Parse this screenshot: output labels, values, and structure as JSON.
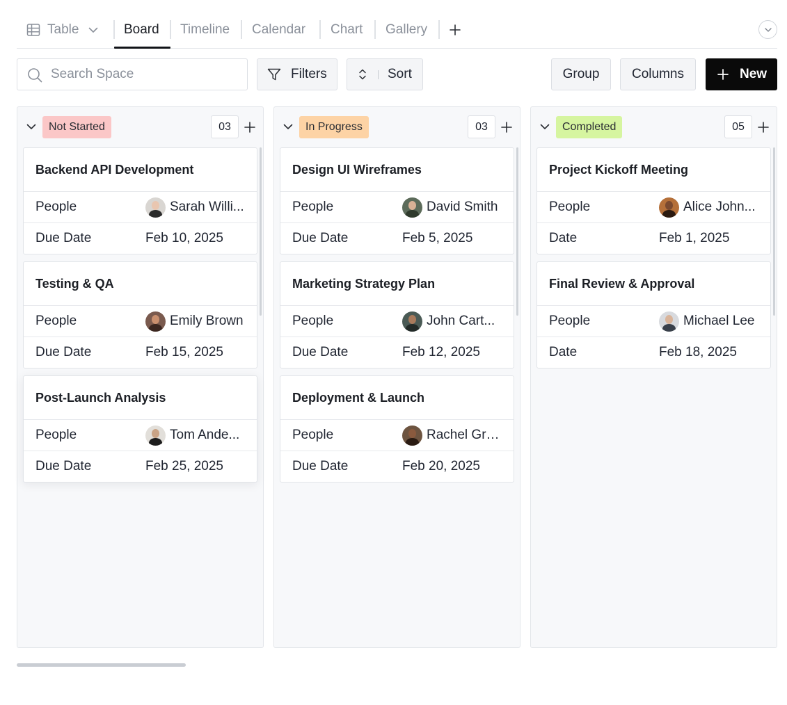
{
  "tabs": {
    "table_label": "Table",
    "board_label": "Board",
    "timeline_label": "Timeline",
    "calendar_label": "Calendar",
    "chart_label": "Chart",
    "gallery_label": "Gallery"
  },
  "toolbar": {
    "search_placeholder": "Search Space",
    "filters_label": "Filters",
    "sort_label": "Sort",
    "group_label": "Group",
    "columns_label": "Columns",
    "new_label": "New"
  },
  "columns": [
    {
      "status": "Not Started",
      "status_color": "#fbc7c7",
      "count": "03",
      "cards": [
        {
          "title": "Backend API Development",
          "people_label": "People",
          "person": "Sarah Willi...",
          "date_label": "Due Date",
          "date": "Feb 10, 2025",
          "avatar_bg": "#d9d6d2",
          "avatar_skin": "#e9c6b0",
          "avatar_cloth": "#2b2b2b"
        },
        {
          "title": "Testing & QA",
          "people_label": "People",
          "person": "Emily Brown",
          "date_label": "Due Date",
          "date": "Feb 15, 2025",
          "avatar_bg": "#7a5a4e",
          "avatar_skin": "#c98f6e",
          "avatar_cloth": "#3a2620"
        },
        {
          "title": "Post-Launch Analysis",
          "people_label": "People",
          "person": "Tom Ande...",
          "date_label": "Due Date",
          "date": "Feb 25, 2025",
          "avatar_bg": "#e2dfda",
          "avatar_skin": "#c9a386",
          "avatar_cloth": "#1d1d1d"
        }
      ]
    },
    {
      "status": "In Progress",
      "status_color": "#fdd3a5",
      "count": "03",
      "cards": [
        {
          "title": "Design UI Wireframes",
          "people_label": "People",
          "person": "David Smith",
          "date_label": "Due Date",
          "date": "Feb 5, 2025",
          "avatar_bg": "#5c6b5a",
          "avatar_skin": "#d8b095",
          "avatar_cloth": "#2f3a2c"
        },
        {
          "title": "Marketing Strategy Plan",
          "people_label": "People",
          "person": "John Cart...",
          "date_label": "Due Date",
          "date": "Feb 12, 2025",
          "avatar_bg": "#4a5a55",
          "avatar_skin": "#a87a5c",
          "avatar_cloth": "#222a28"
        },
        {
          "title": "Deployment & Launch",
          "people_label": "People",
          "person": "Rachel Gre...",
          "date_label": "Due Date",
          "date": "Feb 20, 2025",
          "avatar_bg": "#6d5440",
          "avatar_skin": "#8a5a3e",
          "avatar_cloth": "#2a1b12"
        }
      ]
    },
    {
      "status": "Completed",
      "status_color": "#d6f5a0",
      "count": "05",
      "cards": [
        {
          "title": "Project Kickoff Meeting",
          "people_label": "People",
          "person": "Alice John...",
          "date_label": "Date",
          "date": "Feb 1, 2025",
          "avatar_bg": "#b5703a",
          "avatar_skin": "#7b4a30",
          "avatar_cloth": "#2b1a10"
        },
        {
          "title": "Final Review & Approval",
          "people_label": "People",
          "person": "Michael Lee",
          "date_label": "Date",
          "date": "Feb 18, 2025",
          "avatar_bg": "#d8dade",
          "avatar_skin": "#d9b49a",
          "avatar_cloth": "#39404a"
        }
      ]
    }
  ]
}
